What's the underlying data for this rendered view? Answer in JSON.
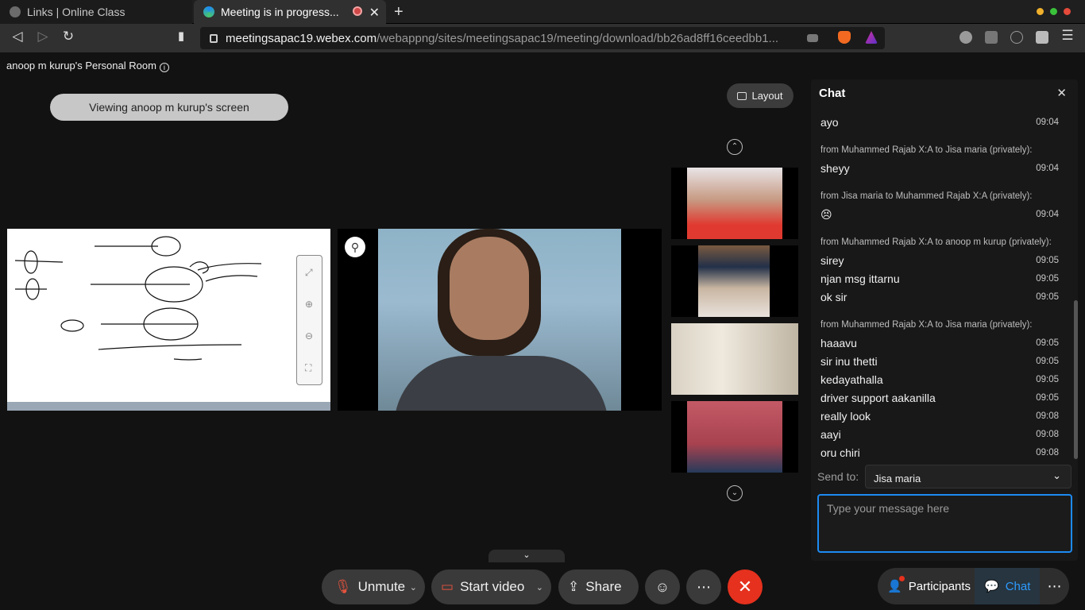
{
  "browser": {
    "tabs": [
      {
        "title": "Links | Online Class"
      },
      {
        "title": "Meeting is in progress..."
      }
    ],
    "url_host": "meetingsapac19.webex.com",
    "url_path": "/webappng/sites/meetingsapac19/meeting/download/bb26ad8ff16ceedbb1..."
  },
  "meeting": {
    "room_title": "anoop m kurup's Personal Room",
    "viewing_label": "Viewing anoop m kurup's screen",
    "layout_label": "Layout"
  },
  "chat": {
    "title": "Chat",
    "messages": [
      {
        "type": "text",
        "text": "ayo",
        "time": "09:04"
      },
      {
        "type": "header",
        "text": "from Muhammed Rajab X:A to Jisa maria (privately):"
      },
      {
        "type": "text",
        "text": "sheyy",
        "time": "09:04"
      },
      {
        "type": "header",
        "text": "from Jisa maria to Muhammed Rajab X:A (privately):"
      },
      {
        "type": "text",
        "text": "😣",
        "time": "09:04"
      },
      {
        "type": "header",
        "text": "from Muhammed Rajab X:A to anoop m kurup (privately):"
      },
      {
        "type": "text",
        "text": "sirey",
        "time": "09:05"
      },
      {
        "type": "text",
        "text": "njan msg ittarnu",
        "time": "09:05"
      },
      {
        "type": "text",
        "text": "ok sir",
        "time": "09:05"
      },
      {
        "type": "header",
        "text": "from Muhammed Rajab X:A to Jisa maria (privately):"
      },
      {
        "type": "text",
        "text": "haaavu",
        "time": "09:05"
      },
      {
        "type": "text",
        "text": "sir inu thetti",
        "time": "09:05"
      },
      {
        "type": "text",
        "text": "kedayathalla",
        "time": "09:05"
      },
      {
        "type": "text",
        "text": "driver support aakanilla",
        "time": "09:05"
      },
      {
        "type": "text",
        "text": "really look",
        "time": "09:08"
      },
      {
        "type": "text",
        "text": "aayi",
        "time": "09:08"
      },
      {
        "type": "text",
        "text": "oru chiri",
        "time": "09:08"
      }
    ],
    "send_to_label": "Send to:",
    "send_to_value": "Jisa maria",
    "input_placeholder": "Type your message here"
  },
  "controls": {
    "unmute": "Unmute",
    "start_video": "Start video",
    "share": "Share",
    "participants": "Participants",
    "chat": "Chat"
  },
  "colors": {
    "accent": "#1d8bf3",
    "end_call": "#e5311e",
    "background": "#121212"
  }
}
